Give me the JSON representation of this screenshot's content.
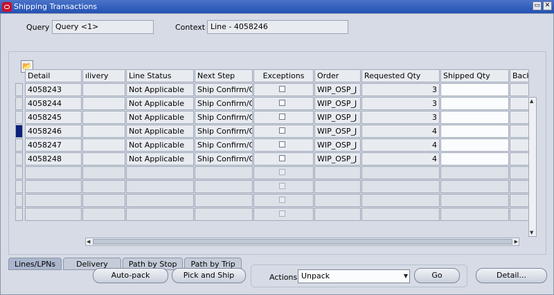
{
  "window": {
    "title": "Shipping Transactions"
  },
  "header": {
    "query_label": "Query",
    "query_value": "Query <1>",
    "context_label": "Context",
    "context_value": "Line - 4058246"
  },
  "columns": [
    "Detail",
    "ılivery",
    "Line Status",
    "Next Step",
    "Exceptions",
    "Order",
    "Requested Qty",
    "Shipped Qty",
    "Back"
  ],
  "rows": [
    {
      "detail": "4058243",
      "status": "Not Applicable",
      "next": "Ship Confirm/Cl",
      "order": "WIP_OSP_J",
      "req": "3",
      "selected": false
    },
    {
      "detail": "4058244",
      "status": "Not Applicable",
      "next": "Ship Confirm/Cl",
      "order": "WIP_OSP_J",
      "req": "3",
      "selected": false
    },
    {
      "detail": "4058245",
      "status": "Not Applicable",
      "next": "Ship Confirm/Cl",
      "order": "WIP_OSP_J",
      "req": "3",
      "selected": false
    },
    {
      "detail": "4058246",
      "status": "Not Applicable",
      "next": "Ship Confirm/Cl",
      "order": "WIP_OSP_J",
      "req": "4",
      "selected": true
    },
    {
      "detail": "4058247",
      "status": "Not Applicable",
      "next": "Ship Confirm/Cl",
      "order": "WIP_OSP_J",
      "req": "4",
      "selected": false
    },
    {
      "detail": "4058248",
      "status": "Not Applicable",
      "next": "Ship Confirm/Cl",
      "order": "WIP_OSP_J",
      "req": "4",
      "selected": false
    }
  ],
  "tabs": [
    "Lines/LPNs",
    "Delivery",
    "Path by Stop",
    "Path by Trip"
  ],
  "buttons": {
    "autopack": "Auto-pack",
    "pickship": "Pick and Ship",
    "actions_label": "Actions",
    "actions_value": "Unpack",
    "go": "Go",
    "detail": "Detail..."
  },
  "icons": {
    "app": "oracle-app-icon",
    "folder": "folder-open-icon"
  }
}
